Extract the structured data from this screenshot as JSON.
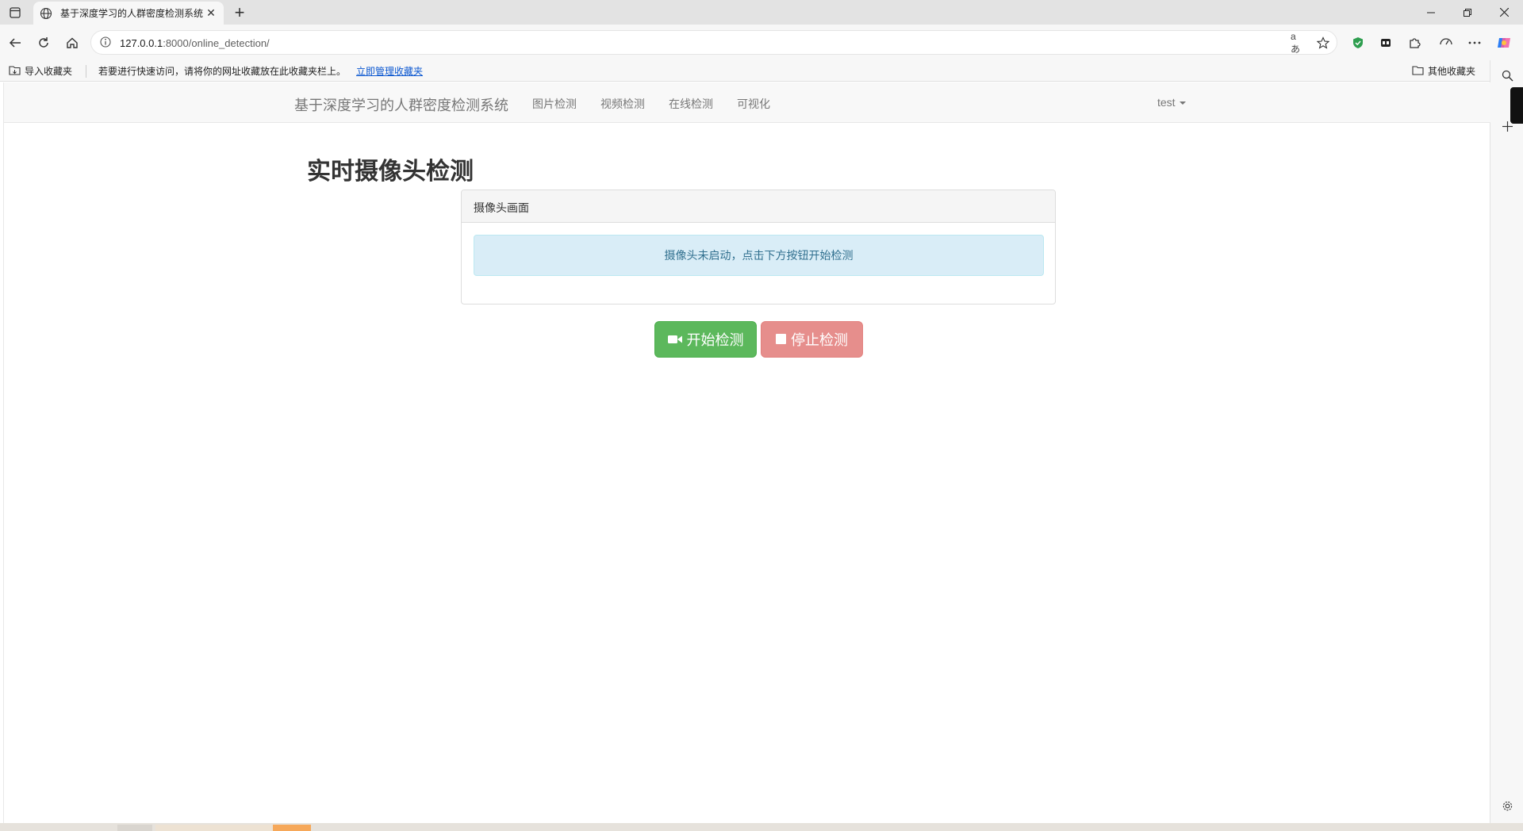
{
  "browser": {
    "tab": {
      "title": "基于深度学习的人群密度检测系统",
      "favicon": "globe-icon"
    },
    "address": {
      "url_host": "127.0.0.1",
      "url_rest": ":8000/online_detection/"
    },
    "omnibox_icons": {
      "read_aloud": "aあ"
    },
    "bookmarks": {
      "import_label": "导入收藏夹",
      "hint_text": "若要进行快速访问，请将你的网址收藏放在此收藏夹栏上。",
      "manage_link": "立即管理收藏夹",
      "other_label": "其他收藏夹"
    }
  },
  "navbar": {
    "brand": "基于深度学习的人群密度检测系统",
    "items": [
      {
        "label": "图片检测"
      },
      {
        "label": "视频检测"
      },
      {
        "label": "在线检测"
      },
      {
        "label": "可视化"
      }
    ],
    "user": "test"
  },
  "main": {
    "heading": "实时摄像头检测",
    "panel": {
      "title": "摄像头画面",
      "message": "摄像头未启动，点击下方按钮开始检测"
    },
    "buttons": {
      "start": "开始检测",
      "stop": "停止检测"
    }
  },
  "colors": {
    "success": "#5cb85c",
    "danger": "#d9534f",
    "info_bg": "#d9edf7",
    "info_text": "#31708f",
    "link": "#0b57d0"
  }
}
